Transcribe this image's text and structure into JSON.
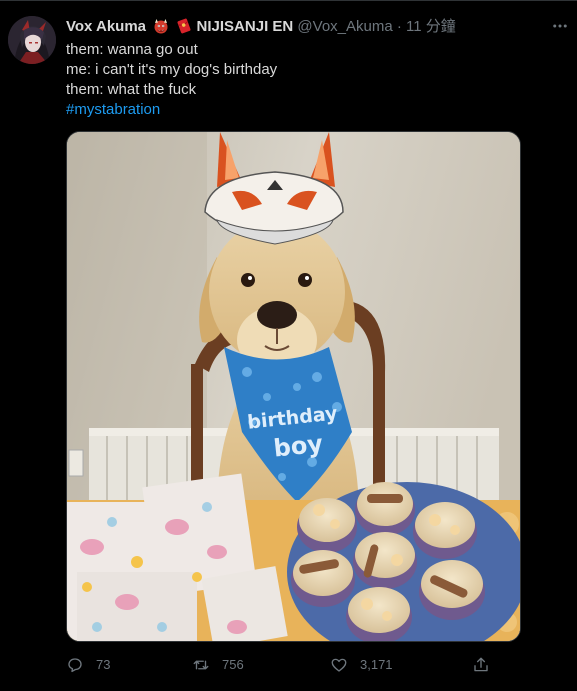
{
  "tweet": {
    "author_name": "Vox Akuma",
    "org_name": "NIJISANJI EN",
    "handle": "@Vox_Akuma",
    "separator": "·",
    "time": "11 分鐘",
    "lines": [
      "them: wanna go out",
      "me: i can't it's my dog's birthday",
      "them: what the fuck"
    ],
    "hashtag": "#mystabration",
    "media": {
      "bandana_text_line1": "birthday",
      "bandana_text_line2": "boy"
    }
  },
  "actions": {
    "reply_count": "73",
    "retweet_count": "756",
    "like_count": "3,171"
  },
  "colors": {
    "background": "#000000",
    "text": "#d9d9d9",
    "muted": "#6e767d",
    "link": "#1d9bf0",
    "border": "#2f3336"
  },
  "icons": [
    "reply-icon",
    "retweet-icon",
    "like-icon",
    "share-icon",
    "more-icon",
    "ogre-emoji-icon",
    "red-envelope-emoji-icon"
  ]
}
